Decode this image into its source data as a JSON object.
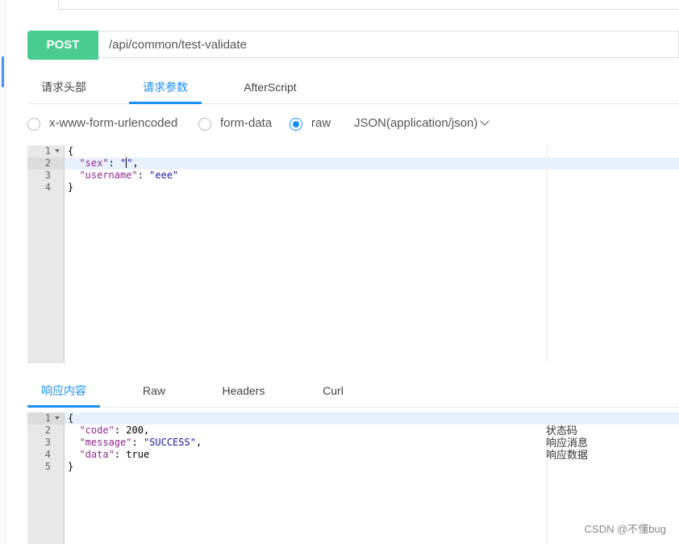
{
  "request": {
    "method": "POST",
    "url": "/api/common/test-validate"
  },
  "request_tabs": [
    {
      "label": "请求头部",
      "active": false
    },
    {
      "label": "请求参数",
      "active": true
    },
    {
      "label": "AfterScript",
      "active": false
    }
  ],
  "body_types": {
    "options": [
      {
        "label": "x-www-form-urlencoded",
        "selected": false
      },
      {
        "label": "form-data",
        "selected": false
      },
      {
        "label": "raw",
        "selected": true
      }
    ],
    "content_type": "JSON(application/json)"
  },
  "request_editor": {
    "line_numbers": [
      "1",
      "2",
      "3",
      "4"
    ],
    "active_line": 2,
    "lines": [
      {
        "t": "{"
      },
      {
        "key": "\"sex\"",
        "sep": ": ",
        "val_open": "\"",
        "cursor": true,
        "val_close": "\"",
        "tail": ","
      },
      {
        "key": "\"username\"",
        "sep": ": ",
        "val": "\"eee\""
      },
      {
        "t": "}"
      }
    ]
  },
  "response_tabs": [
    {
      "label": "响应内容",
      "active": true
    },
    {
      "label": "Raw",
      "active": false
    },
    {
      "label": "Headers",
      "active": false
    },
    {
      "label": "Curl",
      "active": false
    }
  ],
  "response_editor": {
    "line_numbers": [
      "1",
      "2",
      "3",
      "4",
      "5"
    ],
    "active_line": 1,
    "lines": [
      {
        "t": "{"
      },
      {
        "key": "\"code\"",
        "sep": ": ",
        "num": "200",
        "tail": ","
      },
      {
        "key": "\"message\"",
        "sep": ": ",
        "val": "\"SUCCESS\"",
        "tail": ","
      },
      {
        "key": "\"data\"",
        "sep": ": ",
        "num": "true"
      },
      {
        "t": "}"
      }
    ],
    "annotations": [
      "状态码",
      "响应消息",
      "响应数据"
    ]
  },
  "watermark": "CSDN @不懂bug",
  "colors": {
    "method_bg": "#49cc90",
    "accent": "#1890ff",
    "json_key": "#92278f",
    "json_string": "#1a1aa6"
  }
}
